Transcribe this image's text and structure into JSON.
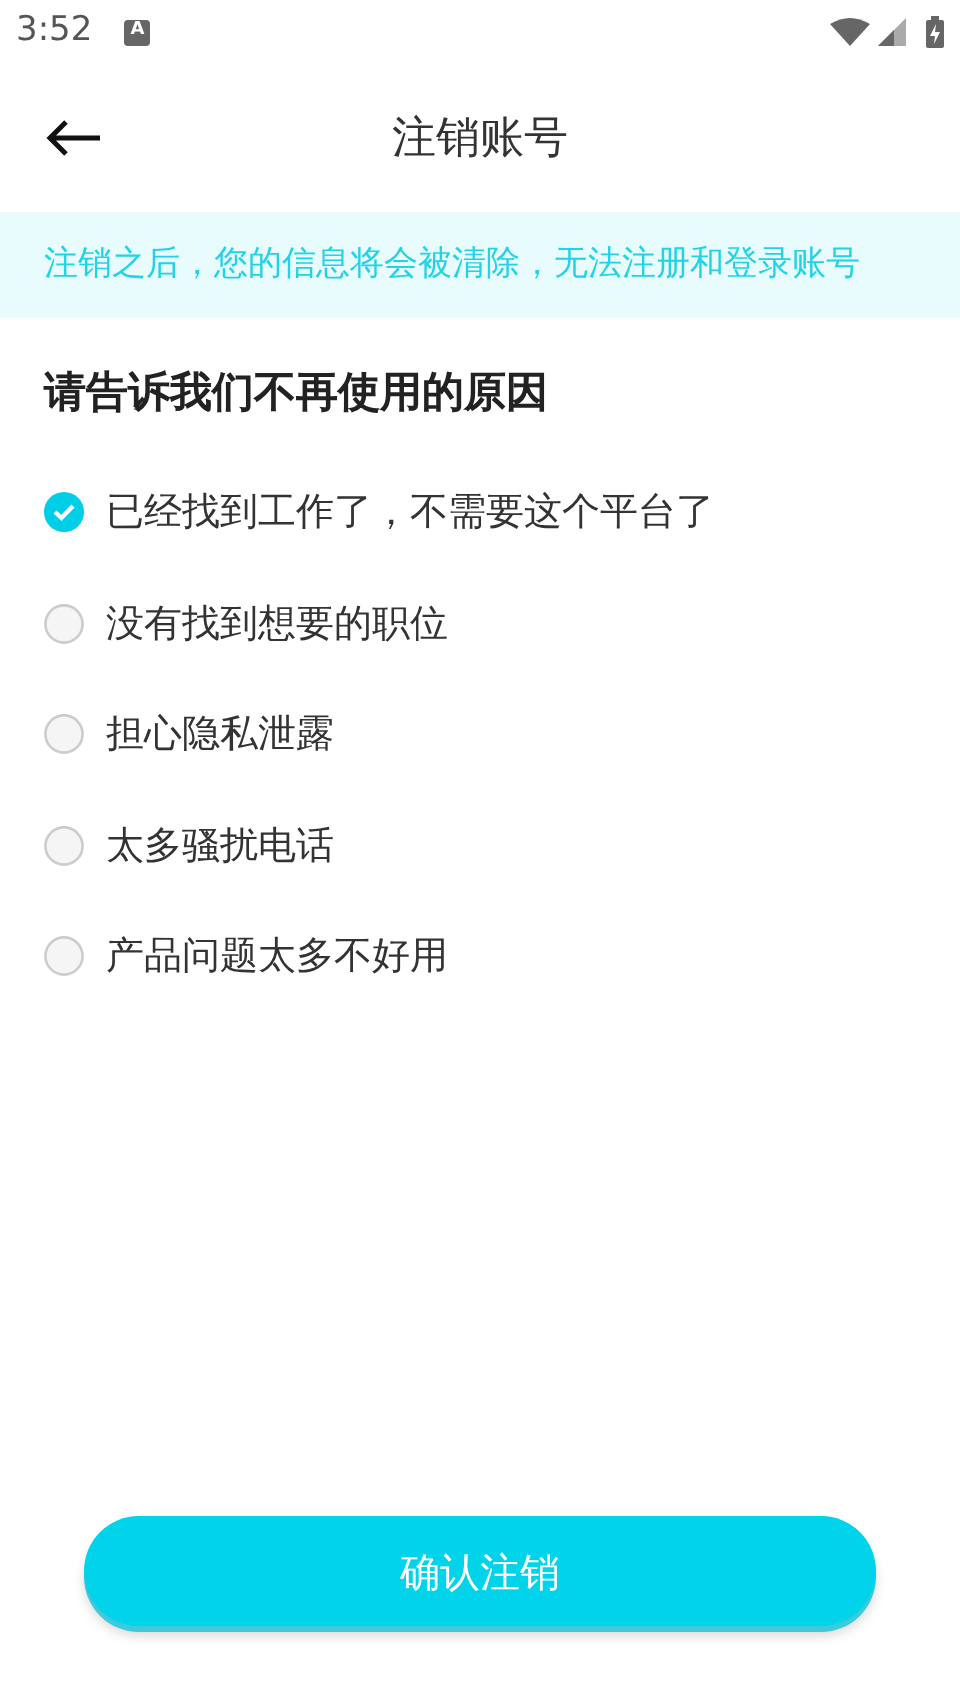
{
  "status_bar": {
    "time": "3:52",
    "badge": "A"
  },
  "header": {
    "title": "注销账号"
  },
  "notice": "注销之后，您的信息将会被清除，无法注册和登录账号",
  "question": "请告诉我们不再使用的原因",
  "reasons": [
    {
      "label": "已经找到工作了，不需要这个平台了",
      "selected": true
    },
    {
      "label": "没有找到想要的职位",
      "selected": false
    },
    {
      "label": "担心隐私泄露",
      "selected": false
    },
    {
      "label": "太多骚扰电话",
      "selected": false
    },
    {
      "label": "产品问题太多不好用",
      "selected": false
    }
  ],
  "confirm_button": "确认注销"
}
